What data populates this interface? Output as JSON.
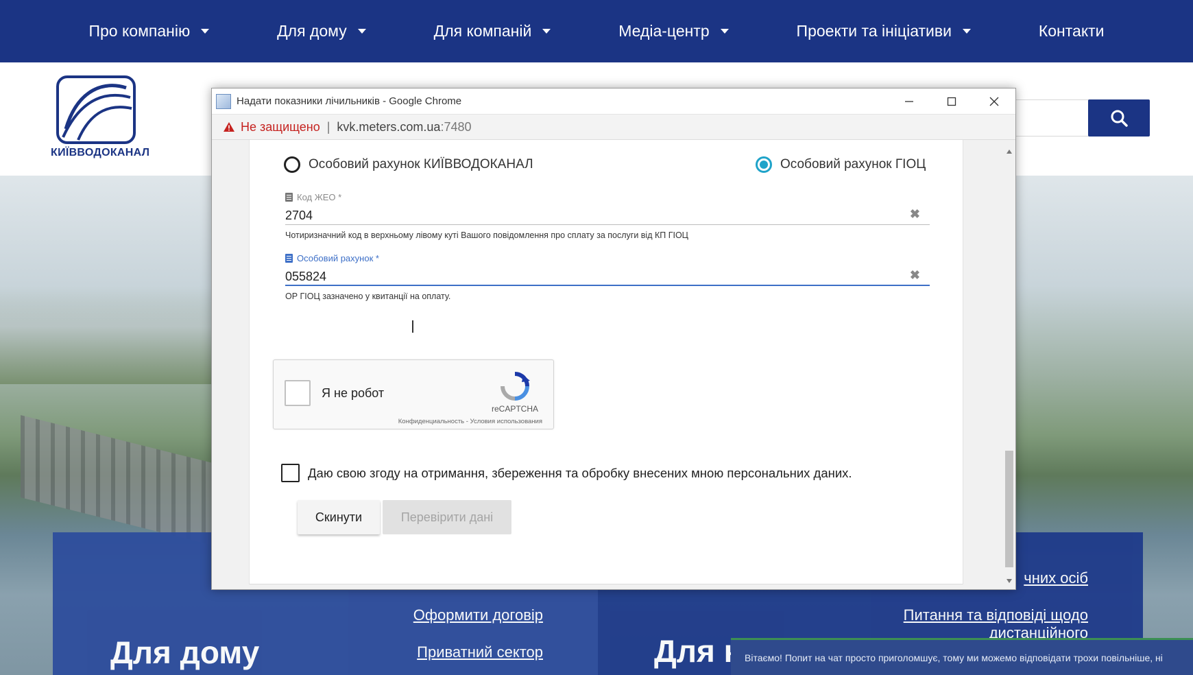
{
  "nav": {
    "items": [
      {
        "label": "Про компанію",
        "has_dropdown": true
      },
      {
        "label": "Для дому",
        "has_dropdown": true
      },
      {
        "label": "Для компаній",
        "has_dropdown": true
      },
      {
        "label": "Медіа-центр",
        "has_dropdown": true
      },
      {
        "label": "Проекти та ініціативи",
        "has_dropdown": true
      },
      {
        "label": "Контакти",
        "has_dropdown": false
      }
    ]
  },
  "site": {
    "logo_text": "КИЇВВОДОКАНАЛ",
    "search_icon": "search-icon",
    "brand_color": "#1b3484"
  },
  "panels": {
    "left": {
      "title": "Для дому",
      "links": [
        "Оформити договір",
        "Приватний сектор"
      ]
    },
    "right": {
      "title": "Для к",
      "links": [
        "чних осіб",
        "Питання та відповіді щодо",
        "дистанційного"
      ]
    }
  },
  "chat": {
    "text": "Вітаємо! Попит на чат просто приголомшує, тому ми можемо відповідати трохи повільніше, ні"
  },
  "popup": {
    "title": "Надати показники лічильників - Google Chrome",
    "security_label": "Не защищено",
    "url_host": "kvk.meters.com.ua",
    "url_port": ":7480",
    "warning_icon": "warning-icon",
    "form": {
      "radio_option_1": "Особовий рахунок КИЇВВОДОКАНАЛ",
      "radio_option_2": "Особовий рахунок ГІОЦ",
      "selected_option": "Особовий рахунок ГІОЦ",
      "zheo_label": "Код ЖЕО *",
      "zheo_value": "2704",
      "zheo_hint": "Чотиризначний код в верхньому лівому куті Вашого повідомлення про сплату за послуги від КП ГІОЦ",
      "account_label": "Особовий рахунок *",
      "account_value": "055824",
      "account_hint": "ОР ГІОЦ зазначено у квитанції на оплату.",
      "recaptcha_label": "Я не робот",
      "recaptcha_brand": "reCAPTCHA",
      "recaptcha_links": "Конфиденциальность - Условия использования",
      "consent_text": "Даю свою згоду на отримання, збереження та обробку внесених мною персональних даних.",
      "reset_button": "Скинути",
      "check_button": "Перевірити дані"
    }
  }
}
